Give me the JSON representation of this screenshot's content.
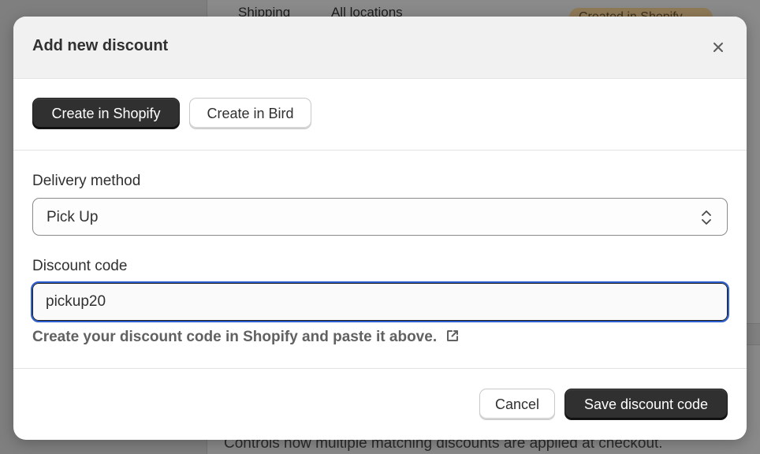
{
  "background": {
    "row_cells": [
      "Shipping",
      "All locations"
    ],
    "badge": "Created in Shopify",
    "bottom_text": "Controls how multiple matching discounts are applied at checkout."
  },
  "modal": {
    "title": "Add new discount",
    "close_icon": "close-icon",
    "tabs": {
      "shopify_label": "Create in Shopify",
      "bird_label": "Create in Bird"
    },
    "delivery": {
      "label": "Delivery method",
      "selected": "Pick Up",
      "icon": "select-chevron-icon"
    },
    "discount": {
      "label": "Discount code",
      "value": "pickup20"
    },
    "help": {
      "text": "Create your discount code in Shopify and paste it above.",
      "icon": "external-link-icon"
    },
    "footer": {
      "cancel_label": "Cancel",
      "save_label": "Save discount code"
    }
  },
  "colors": {
    "primary_button": "#303030",
    "focus_ring": "#2c5ed0",
    "overlay": "#8a8a8a"
  }
}
